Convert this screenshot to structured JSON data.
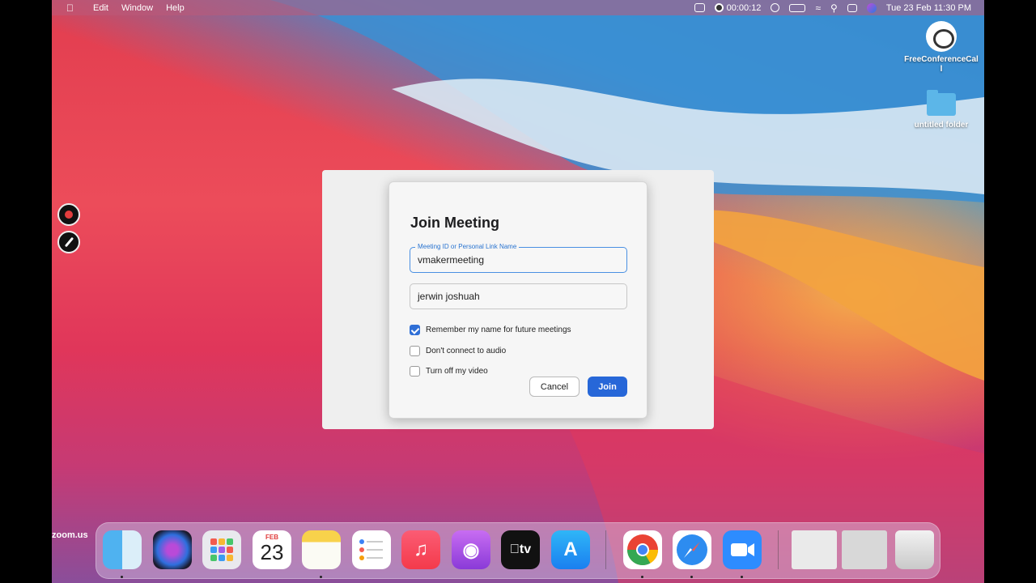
{
  "menubar": {
    "apple": "",
    "app_name": "zoom.us",
    "menus": [
      "Edit",
      "Window",
      "Help"
    ],
    "recording_time": "00:00:12",
    "date_time": "Tue 23 Feb  11:30 PM"
  },
  "desktop": {
    "icons": [
      {
        "label": "FreeConferenceCall",
        "icon": "phone-icon"
      },
      {
        "label": "untitled folder",
        "icon": "folder-icon"
      }
    ]
  },
  "dialog": {
    "title": "Join Meeting",
    "meeting_id_label": "Meeting ID or Personal Link Name",
    "meeting_id_value": "vmakermeeting",
    "name_value": "jerwin joshuah",
    "options": [
      {
        "label": "Remember my name for future meetings",
        "checked": true
      },
      {
        "label": "Don't connect to audio",
        "checked": false
      },
      {
        "label": "Turn off my video",
        "checked": false
      }
    ],
    "cancel_label": "Cancel",
    "join_label": "Join"
  },
  "dock": {
    "calendar_month": "FEB",
    "calendar_day": "23",
    "apps": [
      "finder",
      "siri",
      "launchpad",
      "calendar",
      "notes",
      "reminders",
      "music",
      "podcasts",
      "tv",
      "app-store",
      "chrome",
      "safari",
      "zoom",
      "recent-1",
      "recent-2",
      "trash"
    ]
  },
  "colors": {
    "accent": "#2767d8",
    "wallpaper_red": "#e23d4f",
    "wallpaper_blue": "#2f7cc4",
    "wallpaper_orange": "#f6b248"
  }
}
